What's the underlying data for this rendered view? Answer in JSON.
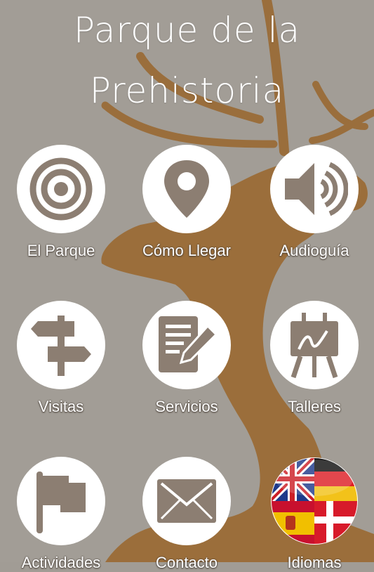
{
  "app": {
    "title_line1": "Parque de la",
    "title_line2": "Prehistoria"
  },
  "colors": {
    "icon": "#8c7e72",
    "background": "#a19c95",
    "silhouette": "#9a6a33"
  },
  "menu": [
    {
      "label": "El Parque",
      "icon": "target-icon"
    },
    {
      "label": "Cómo Llegar",
      "icon": "map-pin-icon"
    },
    {
      "label": "Audioguía",
      "icon": "speaker-icon"
    },
    {
      "label": "Visitas",
      "icon": "signpost-icon"
    },
    {
      "label": "Servicios",
      "icon": "document-edit-icon"
    },
    {
      "label": "Talleres",
      "icon": "easel-icon"
    },
    {
      "label": "Actividades",
      "icon": "flag-icon"
    },
    {
      "label": "Contacto",
      "icon": "envelope-icon"
    },
    {
      "label": "Idiomas",
      "icon": "language-flags-icon"
    }
  ]
}
